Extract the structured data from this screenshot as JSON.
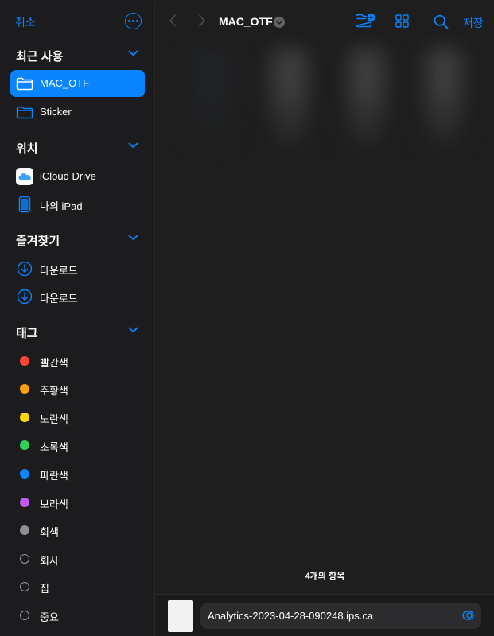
{
  "sidebar": {
    "cancel_label": "취소",
    "more_icon": "ellipsis-circle-icon",
    "sections": {
      "recent": {
        "title": "최근 사용"
      },
      "locations": {
        "title": "위치"
      },
      "favorites": {
        "title": "즐겨찾기"
      },
      "tags": {
        "title": "태그"
      }
    },
    "recent_items": [
      {
        "label": "MAC_OTF",
        "icon": "folder-icon",
        "selected": true
      },
      {
        "label": "Sticker",
        "icon": "folder-icon",
        "selected": false
      }
    ],
    "location_items": [
      {
        "label": "iCloud Drive",
        "icon": "icloud-icon"
      },
      {
        "label": "나의 iPad",
        "icon": "ipad-icon"
      }
    ],
    "favorite_items": [
      {
        "label": "다운로드",
        "icon": "download-circle-icon"
      },
      {
        "label": "다운로드",
        "icon": "download-circle-icon"
      }
    ],
    "tag_items": [
      {
        "label": "빨간색",
        "color": "#ff453a"
      },
      {
        "label": "주황색",
        "color": "#ff9f0a"
      },
      {
        "label": "노란색",
        "color": "#ffd60a"
      },
      {
        "label": "초록색",
        "color": "#30d158"
      },
      {
        "label": "파란색",
        "color": "#0a84ff"
      },
      {
        "label": "보라색",
        "color": "#bf5af2"
      },
      {
        "label": "회색",
        "color": "#8e8e93"
      },
      {
        "label": "회사",
        "color": ""
      },
      {
        "label": "집",
        "color": ""
      },
      {
        "label": "중요",
        "color": ""
      }
    ]
  },
  "toolbar": {
    "title": "MAC_OTF",
    "save_label": "저장"
  },
  "main": {
    "item_count": "4개의 항목"
  },
  "bottom": {
    "filename": "Analytics-2023-04-28-090248.ips.ca"
  },
  "colors": {
    "accent": "#0a84ff",
    "sidebar_bg": "#1c1c1e",
    "main_bg": "#1e1e1e"
  }
}
